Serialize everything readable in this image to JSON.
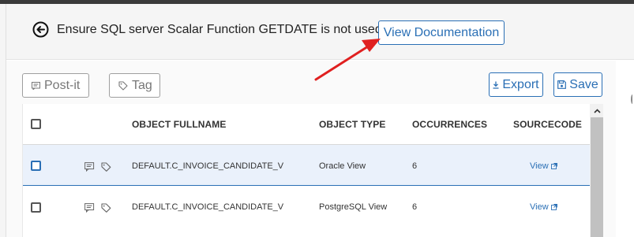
{
  "header": {
    "title": "Ensure SQL server Scalar Function GETDATE is not used",
    "doc_button": "View Documentation"
  },
  "toolbar": {
    "postit_label": "Post-it",
    "tag_label": "Tag",
    "export_label": "Export",
    "save_label": "Save"
  },
  "table": {
    "columns": [
      "OBJECT FULLNAME",
      "OBJECT TYPE",
      "OCCURRENCES",
      "SOURCECODE"
    ],
    "rows": [
      {
        "fullname": "DEFAULT.C_INVOICE_CANDIDATE_V",
        "type": "Oracle View",
        "occurrences": "6",
        "source": "View"
      },
      {
        "fullname": "DEFAULT.C_INVOICE_CANDIDATE_V",
        "type": "PostgreSQL View",
        "occurrences": "6",
        "source": "View"
      }
    ]
  },
  "colors": {
    "accent": "#2a6fb5",
    "annotation_arrow": "#e02020",
    "selected_row": "#eaf1fb"
  },
  "icons": [
    "back-circle-icon",
    "note-icon",
    "tag-icon",
    "download-icon",
    "floppy-disk-icon",
    "comment-icon",
    "external-link-icon",
    "chevron-up-icon"
  ]
}
